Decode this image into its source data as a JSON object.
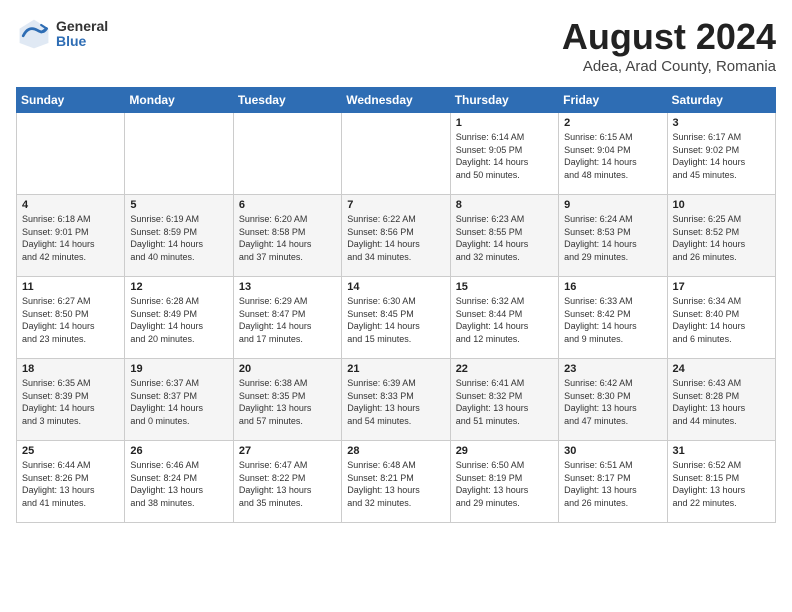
{
  "header": {
    "logo_general": "General",
    "logo_blue": "Blue",
    "month_title": "August 2024",
    "location": "Adea, Arad County, Romania"
  },
  "days_of_week": [
    "Sunday",
    "Monday",
    "Tuesday",
    "Wednesday",
    "Thursday",
    "Friday",
    "Saturday"
  ],
  "weeks": [
    [
      {
        "day": "",
        "info": ""
      },
      {
        "day": "",
        "info": ""
      },
      {
        "day": "",
        "info": ""
      },
      {
        "day": "",
        "info": ""
      },
      {
        "day": "1",
        "info": "Sunrise: 6:14 AM\nSunset: 9:05 PM\nDaylight: 14 hours\nand 50 minutes."
      },
      {
        "day": "2",
        "info": "Sunrise: 6:15 AM\nSunset: 9:04 PM\nDaylight: 14 hours\nand 48 minutes."
      },
      {
        "day": "3",
        "info": "Sunrise: 6:17 AM\nSunset: 9:02 PM\nDaylight: 14 hours\nand 45 minutes."
      }
    ],
    [
      {
        "day": "4",
        "info": "Sunrise: 6:18 AM\nSunset: 9:01 PM\nDaylight: 14 hours\nand 42 minutes."
      },
      {
        "day": "5",
        "info": "Sunrise: 6:19 AM\nSunset: 8:59 PM\nDaylight: 14 hours\nand 40 minutes."
      },
      {
        "day": "6",
        "info": "Sunrise: 6:20 AM\nSunset: 8:58 PM\nDaylight: 14 hours\nand 37 minutes."
      },
      {
        "day": "7",
        "info": "Sunrise: 6:22 AM\nSunset: 8:56 PM\nDaylight: 14 hours\nand 34 minutes."
      },
      {
        "day": "8",
        "info": "Sunrise: 6:23 AM\nSunset: 8:55 PM\nDaylight: 14 hours\nand 32 minutes."
      },
      {
        "day": "9",
        "info": "Sunrise: 6:24 AM\nSunset: 8:53 PM\nDaylight: 14 hours\nand 29 minutes."
      },
      {
        "day": "10",
        "info": "Sunrise: 6:25 AM\nSunset: 8:52 PM\nDaylight: 14 hours\nand 26 minutes."
      }
    ],
    [
      {
        "day": "11",
        "info": "Sunrise: 6:27 AM\nSunset: 8:50 PM\nDaylight: 14 hours\nand 23 minutes."
      },
      {
        "day": "12",
        "info": "Sunrise: 6:28 AM\nSunset: 8:49 PM\nDaylight: 14 hours\nand 20 minutes."
      },
      {
        "day": "13",
        "info": "Sunrise: 6:29 AM\nSunset: 8:47 PM\nDaylight: 14 hours\nand 17 minutes."
      },
      {
        "day": "14",
        "info": "Sunrise: 6:30 AM\nSunset: 8:45 PM\nDaylight: 14 hours\nand 15 minutes."
      },
      {
        "day": "15",
        "info": "Sunrise: 6:32 AM\nSunset: 8:44 PM\nDaylight: 14 hours\nand 12 minutes."
      },
      {
        "day": "16",
        "info": "Sunrise: 6:33 AM\nSunset: 8:42 PM\nDaylight: 14 hours\nand 9 minutes."
      },
      {
        "day": "17",
        "info": "Sunrise: 6:34 AM\nSunset: 8:40 PM\nDaylight: 14 hours\nand 6 minutes."
      }
    ],
    [
      {
        "day": "18",
        "info": "Sunrise: 6:35 AM\nSunset: 8:39 PM\nDaylight: 14 hours\nand 3 minutes."
      },
      {
        "day": "19",
        "info": "Sunrise: 6:37 AM\nSunset: 8:37 PM\nDaylight: 14 hours\nand 0 minutes."
      },
      {
        "day": "20",
        "info": "Sunrise: 6:38 AM\nSunset: 8:35 PM\nDaylight: 13 hours\nand 57 minutes."
      },
      {
        "day": "21",
        "info": "Sunrise: 6:39 AM\nSunset: 8:33 PM\nDaylight: 13 hours\nand 54 minutes."
      },
      {
        "day": "22",
        "info": "Sunrise: 6:41 AM\nSunset: 8:32 PM\nDaylight: 13 hours\nand 51 minutes."
      },
      {
        "day": "23",
        "info": "Sunrise: 6:42 AM\nSunset: 8:30 PM\nDaylight: 13 hours\nand 47 minutes."
      },
      {
        "day": "24",
        "info": "Sunrise: 6:43 AM\nSunset: 8:28 PM\nDaylight: 13 hours\nand 44 minutes."
      }
    ],
    [
      {
        "day": "25",
        "info": "Sunrise: 6:44 AM\nSunset: 8:26 PM\nDaylight: 13 hours\nand 41 minutes."
      },
      {
        "day": "26",
        "info": "Sunrise: 6:46 AM\nSunset: 8:24 PM\nDaylight: 13 hours\nand 38 minutes."
      },
      {
        "day": "27",
        "info": "Sunrise: 6:47 AM\nSunset: 8:22 PM\nDaylight: 13 hours\nand 35 minutes."
      },
      {
        "day": "28",
        "info": "Sunrise: 6:48 AM\nSunset: 8:21 PM\nDaylight: 13 hours\nand 32 minutes."
      },
      {
        "day": "29",
        "info": "Sunrise: 6:50 AM\nSunset: 8:19 PM\nDaylight: 13 hours\nand 29 minutes."
      },
      {
        "day": "30",
        "info": "Sunrise: 6:51 AM\nSunset: 8:17 PM\nDaylight: 13 hours\nand 26 minutes."
      },
      {
        "day": "31",
        "info": "Sunrise: 6:52 AM\nSunset: 8:15 PM\nDaylight: 13 hours\nand 22 minutes."
      }
    ]
  ]
}
